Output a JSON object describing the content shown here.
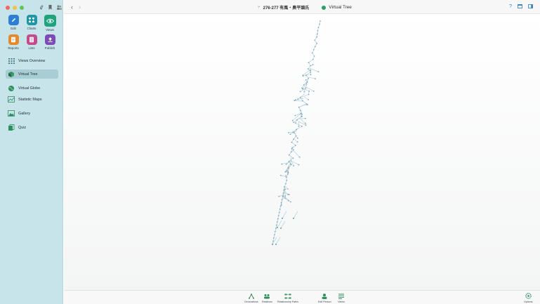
{
  "window": {
    "breadcrumb": "276-277 有風・奥平頭氏",
    "view_title": "Virtual Tree"
  },
  "modules": [
    {
      "label": "Edit",
      "color": "#2b7fd4",
      "icon": "pencil-icon"
    },
    {
      "label": "Charts",
      "color": "#1f97a8",
      "icon": "charts-icon"
    },
    {
      "label": "Views",
      "color": "#1ea37a",
      "icon": "eye-icon"
    },
    {
      "label": "Reports",
      "color": "#e6892d",
      "icon": "reports-icon"
    },
    {
      "label": "Lists",
      "color": "#c44b8b",
      "icon": "list-icon"
    },
    {
      "label": "Publish",
      "color": "#7b4bb8",
      "icon": "publish-icon"
    }
  ],
  "nav_items": [
    {
      "label": "Views Overview",
      "icon": "grid-icon"
    },
    {
      "label": "Virtual Tree",
      "icon": "cube-icon",
      "selected": true
    },
    {
      "label": "Virtual Globe",
      "icon": "globe-icon"
    },
    {
      "label": "Statistic Maps",
      "icon": "map-icon"
    },
    {
      "label": "Gallery",
      "icon": "gallery-icon"
    },
    {
      "label": "Quiz",
      "icon": "quiz-icon"
    }
  ],
  "bottom_bar": {
    "generations": "Generations",
    "relatives": "Relatives",
    "relationship_paths": "Relationship Paths",
    "edit_person": "Edit Person",
    "views": "Views",
    "options": "Options"
  },
  "colors": {
    "accent": "#1ea37a",
    "sidebar": "#c6e4ea",
    "tree_line": "#9fc3d1"
  }
}
